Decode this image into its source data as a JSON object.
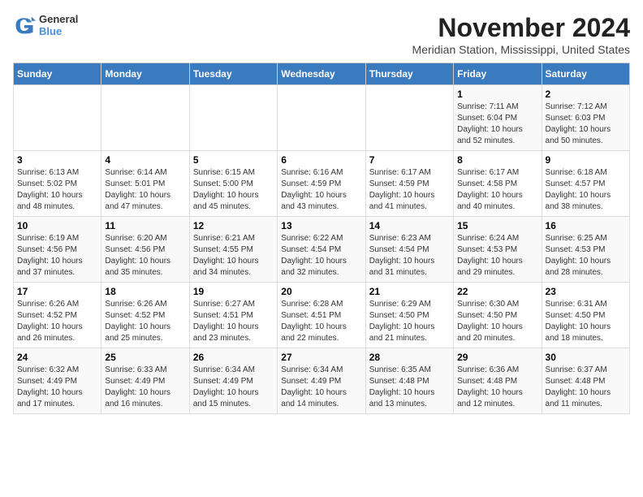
{
  "header": {
    "logo_line1": "General",
    "logo_line2": "Blue",
    "month_title": "November 2024",
    "location": "Meridian Station, Mississippi, United States"
  },
  "days_of_week": [
    "Sunday",
    "Monday",
    "Tuesday",
    "Wednesday",
    "Thursday",
    "Friday",
    "Saturday"
  ],
  "weeks": [
    [
      {
        "day": "",
        "info": ""
      },
      {
        "day": "",
        "info": ""
      },
      {
        "day": "",
        "info": ""
      },
      {
        "day": "",
        "info": ""
      },
      {
        "day": "",
        "info": ""
      },
      {
        "day": "1",
        "info": "Sunrise: 7:11 AM\nSunset: 6:04 PM\nDaylight: 10 hours and 52 minutes."
      },
      {
        "day": "2",
        "info": "Sunrise: 7:12 AM\nSunset: 6:03 PM\nDaylight: 10 hours and 50 minutes."
      }
    ],
    [
      {
        "day": "3",
        "info": "Sunrise: 6:13 AM\nSunset: 5:02 PM\nDaylight: 10 hours and 48 minutes."
      },
      {
        "day": "4",
        "info": "Sunrise: 6:14 AM\nSunset: 5:01 PM\nDaylight: 10 hours and 47 minutes."
      },
      {
        "day": "5",
        "info": "Sunrise: 6:15 AM\nSunset: 5:00 PM\nDaylight: 10 hours and 45 minutes."
      },
      {
        "day": "6",
        "info": "Sunrise: 6:16 AM\nSunset: 4:59 PM\nDaylight: 10 hours and 43 minutes."
      },
      {
        "day": "7",
        "info": "Sunrise: 6:17 AM\nSunset: 4:59 PM\nDaylight: 10 hours and 41 minutes."
      },
      {
        "day": "8",
        "info": "Sunrise: 6:17 AM\nSunset: 4:58 PM\nDaylight: 10 hours and 40 minutes."
      },
      {
        "day": "9",
        "info": "Sunrise: 6:18 AM\nSunset: 4:57 PM\nDaylight: 10 hours and 38 minutes."
      }
    ],
    [
      {
        "day": "10",
        "info": "Sunrise: 6:19 AM\nSunset: 4:56 PM\nDaylight: 10 hours and 37 minutes."
      },
      {
        "day": "11",
        "info": "Sunrise: 6:20 AM\nSunset: 4:56 PM\nDaylight: 10 hours and 35 minutes."
      },
      {
        "day": "12",
        "info": "Sunrise: 6:21 AM\nSunset: 4:55 PM\nDaylight: 10 hours and 34 minutes."
      },
      {
        "day": "13",
        "info": "Sunrise: 6:22 AM\nSunset: 4:54 PM\nDaylight: 10 hours and 32 minutes."
      },
      {
        "day": "14",
        "info": "Sunrise: 6:23 AM\nSunset: 4:54 PM\nDaylight: 10 hours and 31 minutes."
      },
      {
        "day": "15",
        "info": "Sunrise: 6:24 AM\nSunset: 4:53 PM\nDaylight: 10 hours and 29 minutes."
      },
      {
        "day": "16",
        "info": "Sunrise: 6:25 AM\nSunset: 4:53 PM\nDaylight: 10 hours and 28 minutes."
      }
    ],
    [
      {
        "day": "17",
        "info": "Sunrise: 6:26 AM\nSunset: 4:52 PM\nDaylight: 10 hours and 26 minutes."
      },
      {
        "day": "18",
        "info": "Sunrise: 6:26 AM\nSunset: 4:52 PM\nDaylight: 10 hours and 25 minutes."
      },
      {
        "day": "19",
        "info": "Sunrise: 6:27 AM\nSunset: 4:51 PM\nDaylight: 10 hours and 23 minutes."
      },
      {
        "day": "20",
        "info": "Sunrise: 6:28 AM\nSunset: 4:51 PM\nDaylight: 10 hours and 22 minutes."
      },
      {
        "day": "21",
        "info": "Sunrise: 6:29 AM\nSunset: 4:50 PM\nDaylight: 10 hours and 21 minutes."
      },
      {
        "day": "22",
        "info": "Sunrise: 6:30 AM\nSunset: 4:50 PM\nDaylight: 10 hours and 20 minutes."
      },
      {
        "day": "23",
        "info": "Sunrise: 6:31 AM\nSunset: 4:50 PM\nDaylight: 10 hours and 18 minutes."
      }
    ],
    [
      {
        "day": "24",
        "info": "Sunrise: 6:32 AM\nSunset: 4:49 PM\nDaylight: 10 hours and 17 minutes."
      },
      {
        "day": "25",
        "info": "Sunrise: 6:33 AM\nSunset: 4:49 PM\nDaylight: 10 hours and 16 minutes."
      },
      {
        "day": "26",
        "info": "Sunrise: 6:34 AM\nSunset: 4:49 PM\nDaylight: 10 hours and 15 minutes."
      },
      {
        "day": "27",
        "info": "Sunrise: 6:34 AM\nSunset: 4:49 PM\nDaylight: 10 hours and 14 minutes."
      },
      {
        "day": "28",
        "info": "Sunrise: 6:35 AM\nSunset: 4:48 PM\nDaylight: 10 hours and 13 minutes."
      },
      {
        "day": "29",
        "info": "Sunrise: 6:36 AM\nSunset: 4:48 PM\nDaylight: 10 hours and 12 minutes."
      },
      {
        "day": "30",
        "info": "Sunrise: 6:37 AM\nSunset: 4:48 PM\nDaylight: 10 hours and 11 minutes."
      }
    ]
  ]
}
